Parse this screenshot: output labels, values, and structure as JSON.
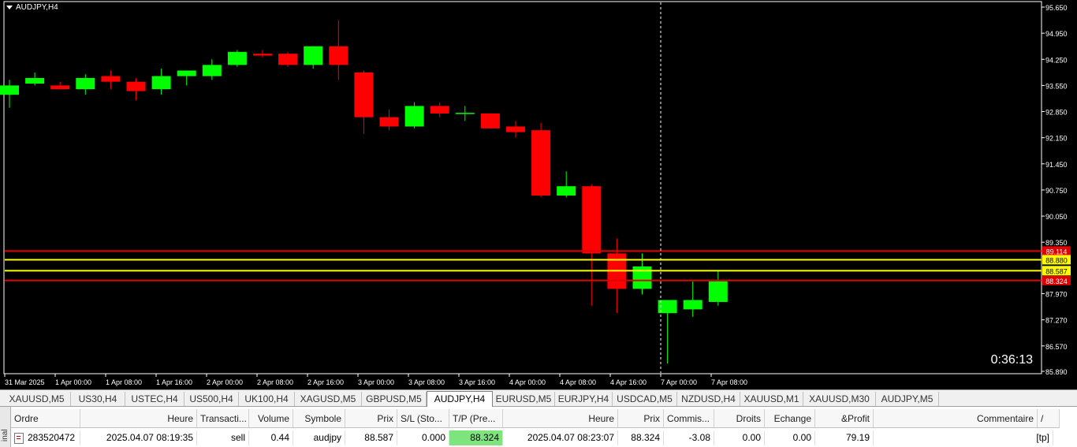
{
  "chart": {
    "title": "AUDJPY,H4",
    "timer": "0:36:13",
    "price_ticks": [
      "95.650",
      "94.950",
      "94.250",
      "93.550",
      "92.850",
      "92.150",
      "91.450",
      "90.750",
      "90.050",
      "89.350",
      "87.970",
      "87.270",
      "86.570",
      "85.890"
    ],
    "time_ticks": [
      "31 Mar 2025",
      "1 Apr 00:00",
      "1 Apr 08:00",
      "1 Apr 16:00",
      "2 Apr 00:00",
      "2 Apr 08:00",
      "2 Apr 16:00",
      "3 Apr 00:00",
      "3 Apr 08:00",
      "3 Apr 16:00",
      "4 Apr 00:00",
      "4 Apr 08:00",
      "4 Apr 16:00",
      "7 Apr 00:00",
      "7 Apr 08:00"
    ],
    "price_labels": [
      {
        "value": "89.114",
        "color": "#e00000"
      },
      {
        "value": "88.880",
        "color": "#ffff00"
      },
      {
        "value": "88.587",
        "color": "#ffff00"
      },
      {
        "value": "88.324",
        "color": "#e00000"
      }
    ],
    "colors": {
      "bull": "#00ff00",
      "bear": "#ff0000",
      "background": "#000000",
      "grid": "#ffffff"
    }
  },
  "chart_data": {
    "type": "candlestick",
    "symbol": "AUDJPY",
    "timeframe": "H4",
    "ylim": [
      85.85,
      95.7
    ],
    "candles": [
      {
        "o": 93.3,
        "h": 93.7,
        "l": 92.95,
        "c": 93.55
      },
      {
        "o": 93.6,
        "h": 93.9,
        "l": 93.55,
        "c": 93.75
      },
      {
        "o": 93.55,
        "h": 93.65,
        "l": 93.45,
        "c": 93.45
      },
      {
        "o": 93.45,
        "h": 93.85,
        "l": 93.3,
        "c": 93.75
      },
      {
        "o": 93.8,
        "h": 93.95,
        "l": 93.45,
        "c": 93.65
      },
      {
        "o": 93.65,
        "h": 93.75,
        "l": 93.15,
        "c": 93.4
      },
      {
        "o": 93.45,
        "h": 94.0,
        "l": 93.3,
        "c": 93.8
      },
      {
        "o": 93.8,
        "h": 93.95,
        "l": 93.55,
        "c": 93.95
      },
      {
        "o": 93.8,
        "h": 94.25,
        "l": 93.7,
        "c": 94.1
      },
      {
        "o": 94.1,
        "h": 94.5,
        "l": 94.05,
        "c": 94.45
      },
      {
        "o": 94.4,
        "h": 94.5,
        "l": 94.3,
        "c": 94.35
      },
      {
        "o": 94.4,
        "h": 94.45,
        "l": 94.05,
        "c": 94.1
      },
      {
        "o": 94.1,
        "h": 94.6,
        "l": 94.0,
        "c": 94.6
      },
      {
        "o": 94.6,
        "h": 95.3,
        "l": 93.7,
        "c": 94.1
      },
      {
        "o": 93.9,
        "h": 93.95,
        "l": 92.25,
        "c": 92.7
      },
      {
        "o": 92.7,
        "h": 92.9,
        "l": 92.35,
        "c": 92.45
      },
      {
        "o": 92.45,
        "h": 93.1,
        "l": 92.4,
        "c": 93.0
      },
      {
        "o": 93.0,
        "h": 93.1,
        "l": 92.7,
        "c": 92.8
      },
      {
        "o": 92.8,
        "h": 93.0,
        "l": 92.6,
        "c": 92.8
      },
      {
        "o": 92.8,
        "h": 92.8,
        "l": 92.4,
        "c": 92.4
      },
      {
        "o": 92.45,
        "h": 92.6,
        "l": 92.15,
        "c": 92.3
      },
      {
        "o": 92.35,
        "h": 92.55,
        "l": 90.55,
        "c": 90.6
      },
      {
        "o": 90.6,
        "h": 91.25,
        "l": 90.55,
        "c": 90.85
      },
      {
        "o": 90.85,
        "h": 90.9,
        "l": 87.65,
        "c": 89.05
      },
      {
        "o": 89.05,
        "h": 89.45,
        "l": 87.45,
        "c": 88.1
      },
      {
        "o": 88.1,
        "h": 89.05,
        "l": 87.95,
        "c": 88.7
      },
      {
        "o": 87.45,
        "h": 87.5,
        "l": 86.1,
        "c": 87.8
      },
      {
        "o": 87.55,
        "h": 88.3,
        "l": 87.35,
        "c": 87.8
      },
      {
        "o": 87.75,
        "h": 88.6,
        "l": 87.65,
        "c": 88.3
      }
    ],
    "levels": [
      {
        "price": 89.114,
        "color": "#e00000"
      },
      {
        "price": 88.88,
        "color": "#ffff00"
      },
      {
        "price": 88.587,
        "color": "#ffff00"
      },
      {
        "price": 88.324,
        "color": "#e00000"
      }
    ]
  },
  "tabs": [
    {
      "label": "XAUUSD,M5"
    },
    {
      "label": "US30,H4"
    },
    {
      "label": "USTEC,H4"
    },
    {
      "label": "US500,H4"
    },
    {
      "label": "UK100,H4"
    },
    {
      "label": "XAGUSD,M5"
    },
    {
      "label": "GBPUSD,M5"
    },
    {
      "label": "AUDJPY,H4",
      "active": true
    },
    {
      "label": "EURUSD,M5"
    },
    {
      "label": "EURJPY,H4"
    },
    {
      "label": "USDCAD,M5"
    },
    {
      "label": "NZDUSD,H4"
    },
    {
      "label": "XAUUSD,M1"
    },
    {
      "label": "XAUUSD,M30"
    },
    {
      "label": "AUDJPY,M5"
    }
  ],
  "terminal": {
    "side_label": "inal",
    "headers": [
      "Ordre",
      "Heure",
      "Transacti...",
      "Volume",
      "Symbole",
      "Prix",
      "S/L (Sto...",
      "T/P (Pre...",
      "Heure",
      "Prix",
      "Commis...",
      "Droits",
      "Echange",
      "&Profit",
      "Commentaire"
    ],
    "sort_mark": "/",
    "row": {
      "ordre": "283520472",
      "heure": "2025.04.07 08:19:35",
      "transaction": "sell",
      "volume": "0.44",
      "symbole": "audjpy",
      "prix": "88.587",
      "sl": "0.000",
      "tp": "88.324",
      "heure2": "2025.04.07 08:23:07",
      "prix2": "88.324",
      "commission": "-3.08",
      "droits": "0.00",
      "echange": "0.00",
      "profit": "79.19",
      "commentaire": "[tp]"
    }
  }
}
